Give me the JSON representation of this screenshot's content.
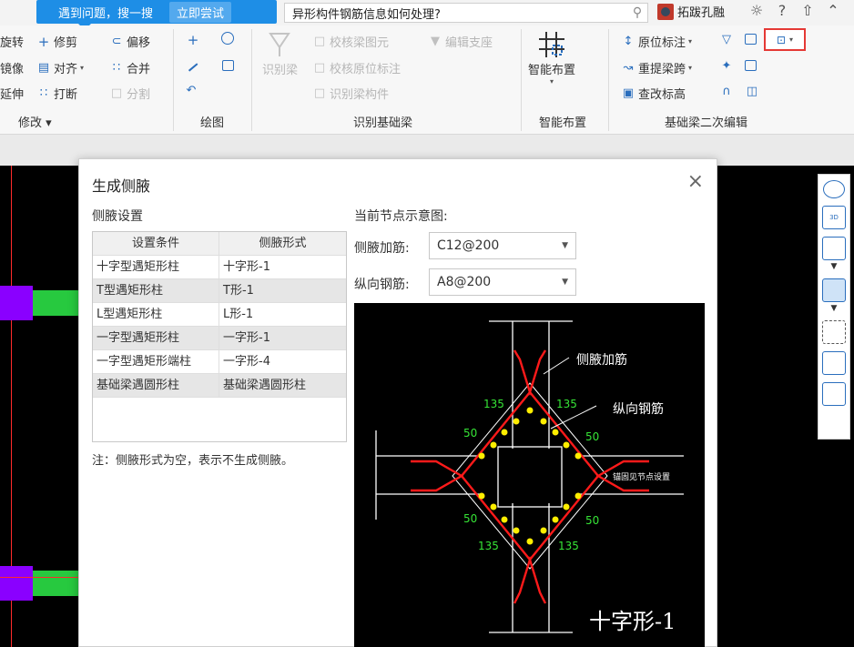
{
  "topbar": {
    "help_text": "遇到问题，搜一搜",
    "try_button": "立即尝试",
    "search_value": "异形构件钢筋信息如何处理?",
    "user_name": "拓跋孔融",
    "icons": [
      "search-icon",
      "user-avatar",
      "chat-icon",
      "help-icon",
      "shirt-icon",
      "up-icon"
    ]
  },
  "ribbon": {
    "modify": {
      "label": "修改",
      "items": [
        "旋转",
        "修剪",
        "偏移",
        "镜像",
        "对齐",
        "合并",
        "延伸",
        "打断",
        "分割"
      ]
    },
    "draw": {
      "label": "绘图"
    },
    "identify": {
      "label": "识别基础梁",
      "big_button": "识别梁",
      "items": [
        "校核梁图元",
        "编辑支座",
        "校核原位标注",
        "识别梁构件"
      ]
    },
    "smart": {
      "label": "智能布置",
      "big_button": "智能布置"
    },
    "secondary": {
      "label": "基础梁二次编辑",
      "items": [
        "原位标注",
        "重提梁跨",
        "查改标高"
      ]
    }
  },
  "dialog": {
    "title": "生成侧腋",
    "section_settings": "侧腋设置",
    "table": {
      "headers": [
        "设置条件",
        "侧腋形式"
      ],
      "rows": [
        [
          "十字型遇矩形柱",
          "十字形-1"
        ],
        [
          "T型遇矩形柱",
          "T形-1"
        ],
        [
          "L型遇矩形柱",
          "L形-1"
        ],
        [
          "一字型遇矩形柱",
          "一字形-1"
        ],
        [
          "一字型遇矩形端柱",
          "一字形-4"
        ],
        [
          "基础梁遇圆形柱",
          "基础梁遇圆形柱"
        ]
      ]
    },
    "note": "注：侧腋形式为空，表示不生成侧腋。",
    "preview_label": "当前节点示意图:",
    "haunch_rebar_label": "侧腋加筋:",
    "haunch_rebar_value": "C12@200",
    "long_rebar_label": "纵向钢筋:",
    "long_rebar_value": "A8@200",
    "diagram": {
      "label_haunch": "侧腋加筋",
      "label_long": "纵向钢筋",
      "angle": "135",
      "dim": "50",
      "note": "锚固见节点设置",
      "title": "十字形-1"
    }
  },
  "colors": {
    "accent": "#1e8ee6",
    "highlight_border": "#e53935",
    "canvas_bg": "#000000",
    "green_bar": "#27c93f",
    "purple_column": "#8a00ff"
  }
}
